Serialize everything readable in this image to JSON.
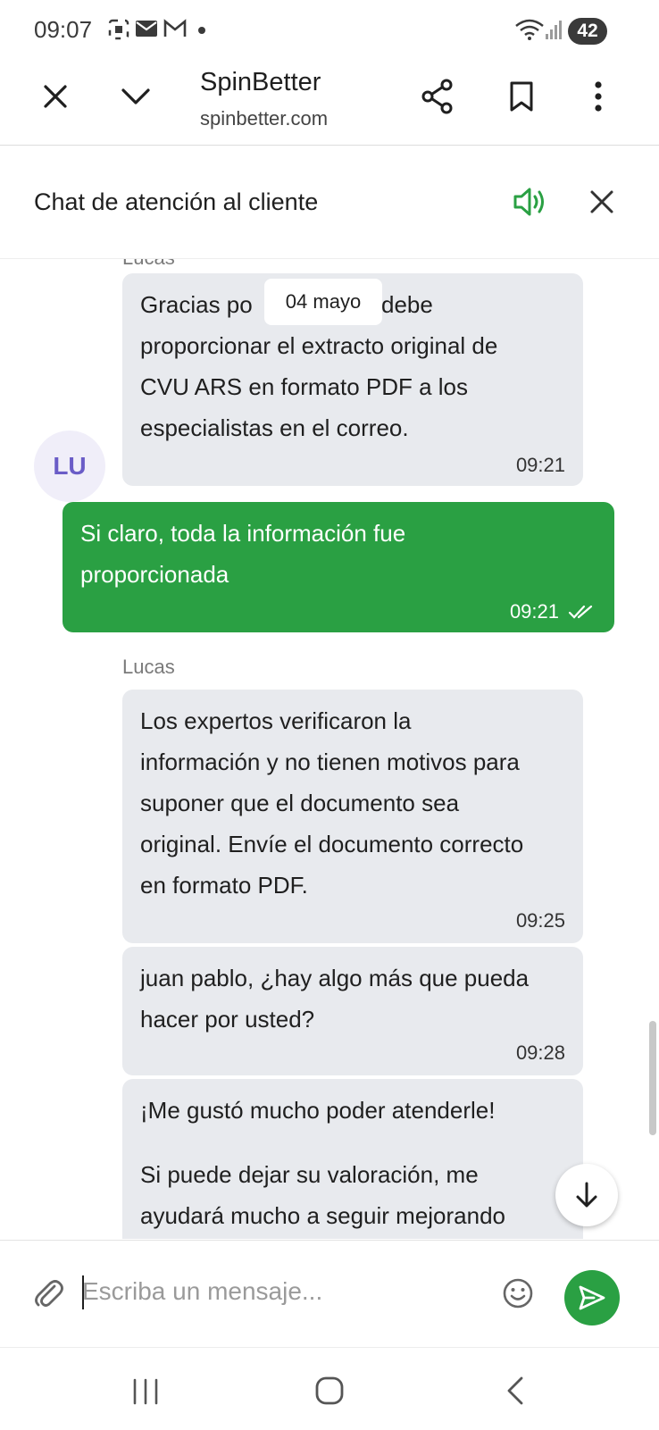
{
  "status_bar": {
    "time": "09:07",
    "battery": "42"
  },
  "browser": {
    "title": "SpinBetter",
    "url": "spinbetter.com"
  },
  "chat_header": {
    "title": "Chat de atención al cliente"
  },
  "colors": {
    "accent": "#2aa043",
    "incoming_bubble": "#e8eaee",
    "avatar_text": "#6a5cc7"
  },
  "date_chip": "04 mayo",
  "avatar": {
    "initials": "LU"
  },
  "messages": [
    {
      "sender": "Lucas",
      "lines": [
        "Gracias po",
        "debe",
        "proporcionar el extracto original de",
        "CVU ARS en formato PDF a los",
        "especialistas en el correo."
      ],
      "time": "09:21"
    },
    {
      "lines": [
        "Si claro, toda la información fue",
        "proporcionada"
      ],
      "time": "09:21"
    },
    {
      "sender": "Lucas",
      "lines": [
        "Los expertos verificaron la",
        "información y no tienen motivos para",
        "suponer que el documento sea",
        "original. Envíe el documento correcto",
        "en formato PDF."
      ],
      "time": "09:25"
    },
    {
      "lines": [
        "juan pablo, ¿hay algo más que pueda",
        "hacer por usted?"
      ],
      "time": "09:28"
    },
    {
      "lines": [
        "¡Me gustó mucho poder atenderle!",
        "Si puede dejar su valoración, me",
        "ayudará mucho a seguir mejorando"
      ]
    }
  ],
  "composer": {
    "placeholder": "Escriba un mensaje..."
  }
}
